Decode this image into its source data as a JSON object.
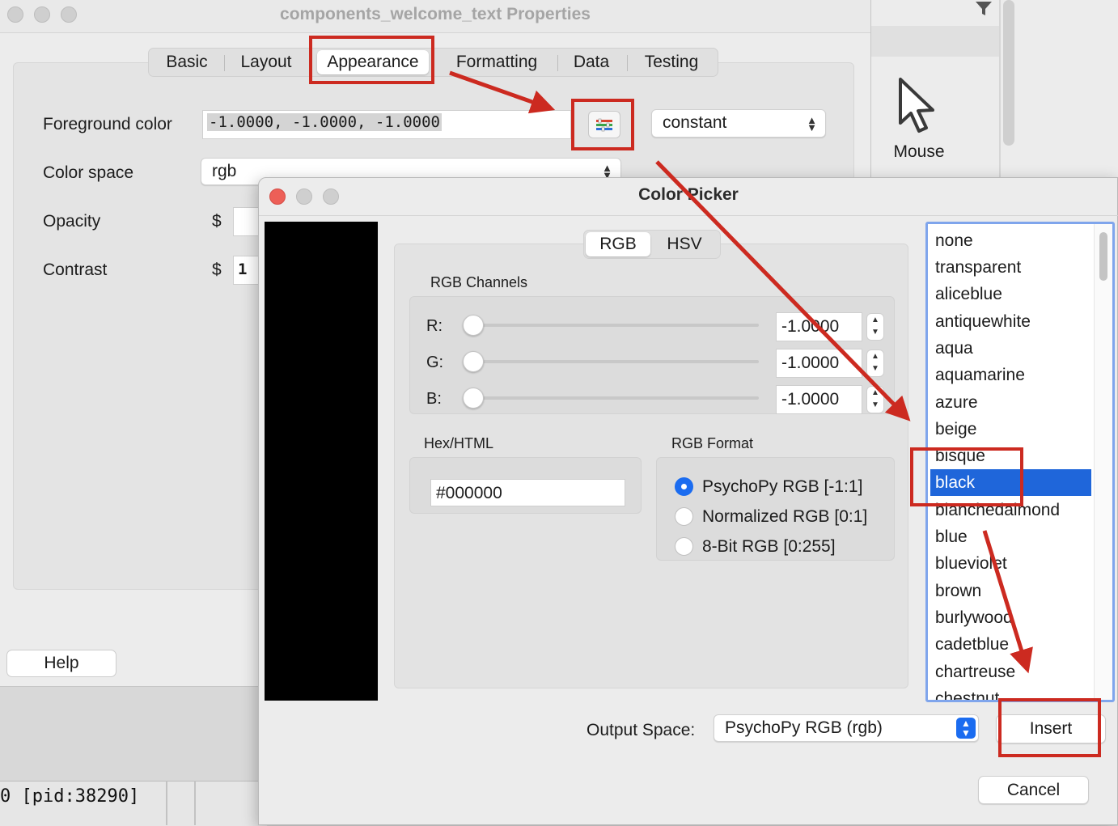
{
  "background": {
    "terminal_text": "0 [pid:38290]",
    "mouse_label": "Mouse"
  },
  "properties_window": {
    "title": "components_welcome_text Properties",
    "tabs": [
      "Basic",
      "Layout",
      "Appearance",
      "Formatting",
      "Data",
      "Testing"
    ],
    "active_tab": "Appearance",
    "foreground_label": "Foreground color",
    "foreground_value": "-1.0000, -1.0000, -1.0000",
    "foreground_mode": "constant",
    "colorspace_label": "Color space",
    "colorspace_value": "rgb",
    "opacity_label": "Opacity",
    "opacity_prefix": "$",
    "contrast_label": "Contrast",
    "contrast_prefix": "$",
    "contrast_value": "1",
    "help_button": "Help"
  },
  "color_picker": {
    "title": "Color Picker",
    "mode_tabs": [
      "RGB",
      "HSV"
    ],
    "active_mode": "RGB",
    "channels_title": "RGB Channels",
    "channels": [
      {
        "label": "R:",
        "value": "-1.0000",
        "level": 0
      },
      {
        "label": "G:",
        "value": "-1.0000",
        "level": 0
      },
      {
        "label": "B:",
        "value": "-1.0000",
        "level": 0
      }
    ],
    "hex_title": "Hex/HTML",
    "hex_value": "#000000",
    "format_title": "RGB Format",
    "formats": [
      "PsychoPy RGB [-1:1]",
      "Normalized RGB [0:1]",
      "8-Bit RGB [0:255]"
    ],
    "selected_format": "PsychoPy RGB [-1:1]",
    "preview_color": "#000000",
    "color_names": [
      "none",
      "transparent",
      "aliceblue",
      "antiquewhite",
      "aqua",
      "aquamarine",
      "azure",
      "beige",
      "bisque",
      "black",
      "blanchedalmond",
      "blue",
      "blueviolet",
      "brown",
      "burlywood",
      "cadetblue",
      "chartreuse",
      "chestnut"
    ],
    "selected_color_name": "black",
    "output_label": "Output Space:",
    "output_value": "PsychoPy RGB (rgb)",
    "insert_button": "Insert",
    "cancel_button": "Cancel"
  },
  "colors": {
    "annotation_red": "#cc2a20",
    "selection_blue": "#1f66da",
    "accent_blue": "#1b6cf0"
  }
}
